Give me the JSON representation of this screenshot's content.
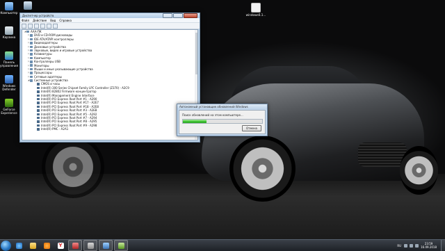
{
  "desktop": {
    "icons": [
      {
        "label": "Компьютер",
        "icon": "computer-icon"
      },
      {
        "label": "Корзина",
        "icon": "recycle-bin-icon"
      },
      {
        "label": "Панель управления",
        "icon": "control-panel-icon"
      },
      {
        "label": "Windows Defender",
        "icon": "shield-icon"
      },
      {
        "label": "GeForce Experience",
        "icon": "geforce-icon"
      },
      {
        "label": "",
        "icon": "user-icon"
      },
      {
        "label": "windows6.1...",
        "icon": "file-icon"
      }
    ]
  },
  "device_manager": {
    "title": "Диспетчер устройств",
    "menu": [
      "Файл",
      "Действие",
      "Вид",
      "Справка"
    ],
    "tree": [
      {
        "level": 0,
        "label": "AAA-ПК",
        "expanded": true
      },
      {
        "level": 1,
        "label": "DVD и CD-ROM дисководы"
      },
      {
        "level": 1,
        "label": "IDE ATA/ATAPI контроллеры"
      },
      {
        "level": 1,
        "label": "Видеоадаптеры"
      },
      {
        "level": 1,
        "label": "Дисковые устройства"
      },
      {
        "level": 1,
        "label": "Звуковые, видео и игровые устройства"
      },
      {
        "level": 1,
        "label": "Клавиатуры"
      },
      {
        "level": 1,
        "label": "Компьютер"
      },
      {
        "level": 1,
        "label": "Контроллеры USB"
      },
      {
        "level": 1,
        "label": "Мониторы"
      },
      {
        "level": 1,
        "label": "Мыши и иные указывающие устройства"
      },
      {
        "level": 1,
        "label": "Процессоры"
      },
      {
        "level": 1,
        "label": "Сетевые адаптеры"
      },
      {
        "level": 1,
        "label": "Системные устройства",
        "expanded": true
      },
      {
        "level": 2,
        "label": "CMOS и часы"
      },
      {
        "level": 2,
        "label": "Intel(R) 300 Series Chipset Family LPC Controller (Z370) - A2C9"
      },
      {
        "level": 2,
        "label": "Intel(R) 82802 Firmware концентратор"
      },
      {
        "level": 2,
        "label": "Intel(R) Management Engine Interface"
      },
      {
        "level": 2,
        "label": "Intel(R) PCI Express Root Port #1 - A290"
      },
      {
        "level": 2,
        "label": "Intel(R) PCI Express Root Port #17 - A2E7"
      },
      {
        "level": 2,
        "label": "Intel(R) PCI Express Root Port #18 - A2E8"
      },
      {
        "level": 2,
        "label": "Intel(R) PCI Express Root Port #3 - A2EB"
      },
      {
        "level": 2,
        "label": "Intel(R) PCI Express Root Port #5 - A292"
      },
      {
        "level": 2,
        "label": "Intel(R) PCI Express Root Port #7 - A294"
      },
      {
        "level": 2,
        "label": "Intel(R) PCI Express Root Port #8 - A295"
      },
      {
        "level": 2,
        "label": "Intel(R) PCI Express Root Port #9 - A298"
      },
      {
        "level": 2,
        "label": "Intel(R) PMC - A2A1"
      }
    ]
  },
  "update_dialog": {
    "title": "Автономный установщик обновлений Windows",
    "message": "Поиск обновлений на этом компьютере...",
    "progress": 0.3,
    "cancel_label": "Отмена"
  },
  "taskbar": {
    "pinned": [
      "ie-icon",
      "explorer-icon",
      "media-player-icon",
      "yandex-icon",
      "app-icon",
      "app-icon",
      "app-icon",
      "app-icon"
    ],
    "yandex_glyph": "Y",
    "language": "RU",
    "time": "23:59",
    "date": "16.09.2018"
  }
}
